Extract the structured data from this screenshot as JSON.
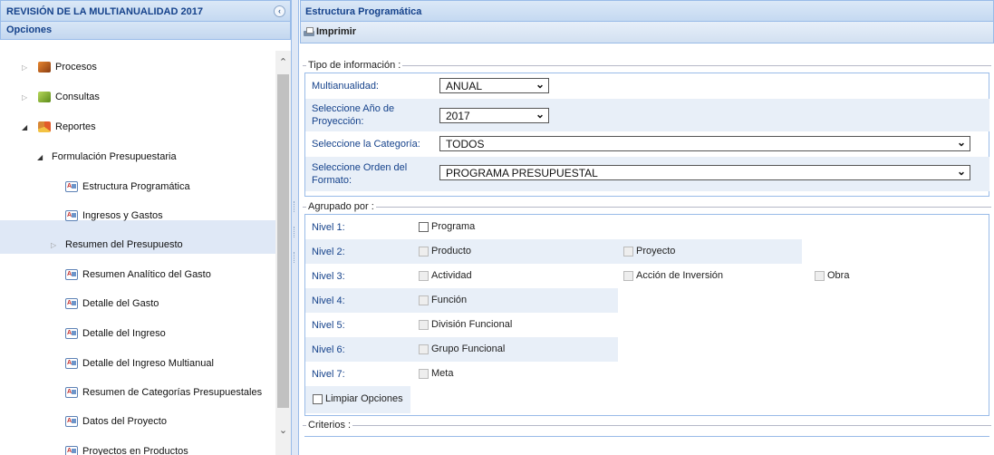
{
  "left": {
    "title": "REVISIÓN DE LA MULTIANUALIDAD 2017",
    "subtitle": "Opciones",
    "tree": [
      {
        "label": "Procesos",
        "icon": "book-icon"
      },
      {
        "label": "Consultas",
        "icon": "leaf-icon"
      },
      {
        "label": "Reportes",
        "icon": "pie-chart-icon"
      },
      {
        "label": "Formulación Presupuestaria"
      },
      {
        "label": "Estructura Programática",
        "icon": "report-icon"
      },
      {
        "label": "Ingresos y Gastos",
        "icon": "report-icon"
      },
      {
        "label": "Resumen del Presupuesto"
      },
      {
        "label": "Resumen Analítico del Gasto",
        "icon": "report-icon"
      },
      {
        "label": "Detalle del Gasto",
        "icon": "report-icon"
      },
      {
        "label": "Detalle del Ingreso",
        "icon": "report-icon"
      },
      {
        "label": "Detalle del Ingreso Multianual",
        "icon": "report-icon"
      },
      {
        "label": "Resumen de Categorías Presupuestales",
        "icon": "report-icon"
      },
      {
        "label": "Datos del Proyecto",
        "icon": "report-icon"
      },
      {
        "label": "Proyectos en Productos",
        "icon": "report-icon"
      }
    ]
  },
  "right": {
    "title": "Estructura Programática",
    "toolbar": {
      "print_label": "Imprimir"
    },
    "tipo": {
      "legend": "Tipo de información :",
      "rows": [
        {
          "label": "Multianualidad:",
          "value": "ANUAL"
        },
        {
          "label": "Seleccione Año de Proyección:",
          "value": "2017"
        },
        {
          "label": "Seleccione la Categoría:",
          "value": "TODOS"
        },
        {
          "label": "Seleccione Orden del Formato:",
          "value": "PROGRAMA PRESUPUESTAL"
        }
      ]
    },
    "agrupado": {
      "legend": "Agrupado por :",
      "levels": [
        {
          "label": "Nivel 1:",
          "opts": [
            "Programa"
          ]
        },
        {
          "label": "Nivel 2:",
          "opts": [
            "Producto",
            "Proyecto"
          ]
        },
        {
          "label": "Nivel 3:",
          "opts": [
            "Actividad",
            "Acción de Inversión",
            "Obra"
          ]
        },
        {
          "label": "Nivel 4:",
          "opts": [
            "Función"
          ]
        },
        {
          "label": "Nivel 5:",
          "opts": [
            "División Funcional"
          ]
        },
        {
          "label": "Nivel 6:",
          "opts": [
            "Grupo Funcional"
          ]
        },
        {
          "label": "Nivel 7:",
          "opts": [
            "Meta"
          ]
        }
      ],
      "clear_label": "Limpiar Opciones"
    },
    "criterios": {
      "legend": "Criterios :"
    }
  }
}
